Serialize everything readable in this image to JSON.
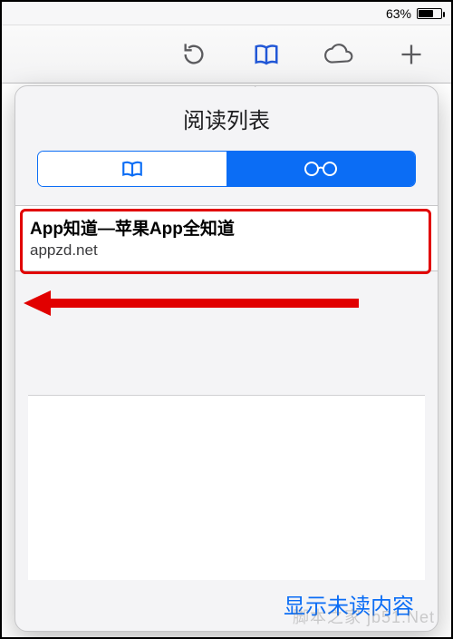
{
  "status": {
    "battery_pct": "63%"
  },
  "popover": {
    "title": "阅读列表",
    "segments": {
      "bookmarks_selected": false,
      "reading_selected": true
    }
  },
  "list": {
    "items": [
      {
        "title": "App知道—苹果App全知道",
        "url": "appzd.net"
      }
    ]
  },
  "footer": {
    "show_unread": "显示未读内容"
  },
  "watermark": "脚本之家 jb51.Net"
}
